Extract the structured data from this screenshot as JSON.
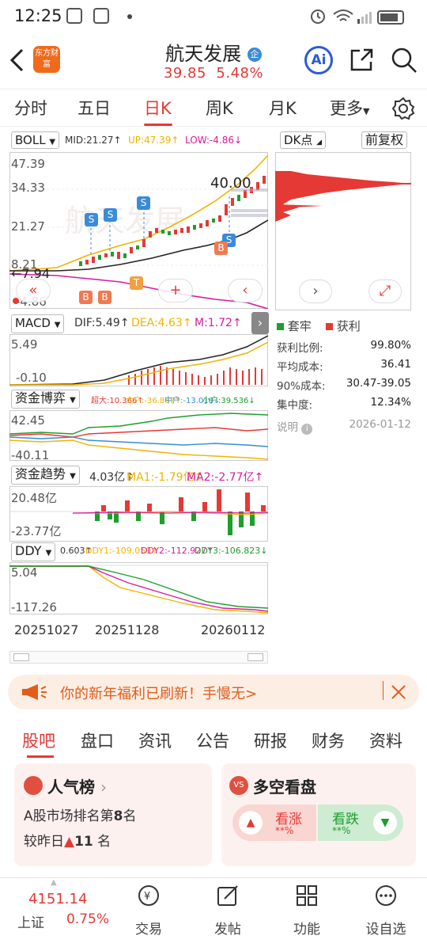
{
  "status_bar": {
    "time": "12:25"
  },
  "header": {
    "logo_text": "东方财富",
    "title": "航天发展",
    "badge": "企",
    "price": "39.85",
    "change_pct": "5.48%",
    "ai_label": "Ai",
    "icons": [
      "back-arrow-icon",
      "share-icon",
      "search-icon"
    ]
  },
  "period_tabs": {
    "items": [
      "分时",
      "五日",
      "日K",
      "周K",
      "月K",
      "更多"
    ],
    "active": "日K"
  },
  "boll": {
    "selector": "BOLL",
    "mid": "MID:21.27↑",
    "up": "UP:47.39↑",
    "low": "LOW:-4.86↓",
    "axis": [
      "47.39",
      "34.33",
      "21.27",
      "8.21",
      "-4.86"
    ],
    "marker_low": "7.94",
    "marker_high": "40.00",
    "signals_s": [
      "S",
      "S",
      "S",
      "S"
    ],
    "signals_b": [
      "B",
      "B",
      "B"
    ],
    "signal_t": "T"
  },
  "dk_panel": {
    "selector": "DK点",
    "restore": "前复权",
    "legend_trapped": "套牢",
    "legend_profit": "获利",
    "stats": [
      {
        "label": "获利比例:",
        "value": "99.80%"
      },
      {
        "label": "平均成本:",
        "value": "36.41"
      },
      {
        "label": "90%成本:",
        "value": "30.47-39.05"
      },
      {
        "label": "集中度:",
        "value": "12.34%"
      }
    ],
    "note": "说明",
    "date": "2026-01-12"
  },
  "macd": {
    "selector": "MACD",
    "dif": "DIF:5.49↑",
    "dea": "DEA:4.63↑",
    "m": "M:1.72↑",
    "axis": [
      "5.49",
      "-0.10"
    ]
  },
  "fund_game": {
    "selector": "资金博弈",
    "super": "超大:10.366↑",
    "large": "大户:-36.887↑",
    "medium": "中户:-13.018↓",
    "small": "小户:39.536↓",
    "axis": [
      "42.45",
      "-40.11"
    ]
  },
  "fund_trend": {
    "selector": "资金趋势",
    "val": "4.03亿↑",
    "ma1": "MA1:-1.79亿↑",
    "ma2": "MA2:-2.77亿↑",
    "axis": [
      "20.48亿",
      "-23.77亿"
    ]
  },
  "ddy": {
    "selector": "DDY",
    "val": "0.603↑",
    "ddy1": "DDY1:-109.059↑",
    "ddy2": "DDY2:-112.927↑",
    "ddy3": "DDY3:-106.823↓",
    "axis": [
      "5.04",
      "-117.26"
    ]
  },
  "dates": [
    "20251027",
    "20251128",
    "20260112"
  ],
  "banner": {
    "text": "你的新年福利已刷新！手慢无>"
  },
  "sub_tabs": {
    "items": [
      "股吧",
      "盘口",
      "资讯",
      "公告",
      "研报",
      "财务",
      "资料"
    ],
    "active": "股吧"
  },
  "popularity": {
    "title": "人气榜",
    "line1_prefix": "A股市场排名第",
    "rank": "8",
    "line1_suffix": "名",
    "line2_prefix": "较昨日",
    "change": "11",
    "line2_suffix": "名"
  },
  "bull_bear": {
    "title": "多空看盘",
    "bull": "看涨",
    "bear": "看跌",
    "bull_pct": "**%",
    "bear_pct": "**%"
  },
  "bottom_nav": {
    "index_value": "4151.14",
    "index_name": "上证",
    "index_change": "0.75%",
    "items": [
      "交易",
      "发帖",
      "功能",
      "设自选"
    ]
  },
  "colors": {
    "red": "#e53935",
    "green": "#1e9e2d",
    "yellow": "#f0b400",
    "magenta": "#d81b9c",
    "blue": "#3a8bd8",
    "orange": "#f06a1c"
  }
}
